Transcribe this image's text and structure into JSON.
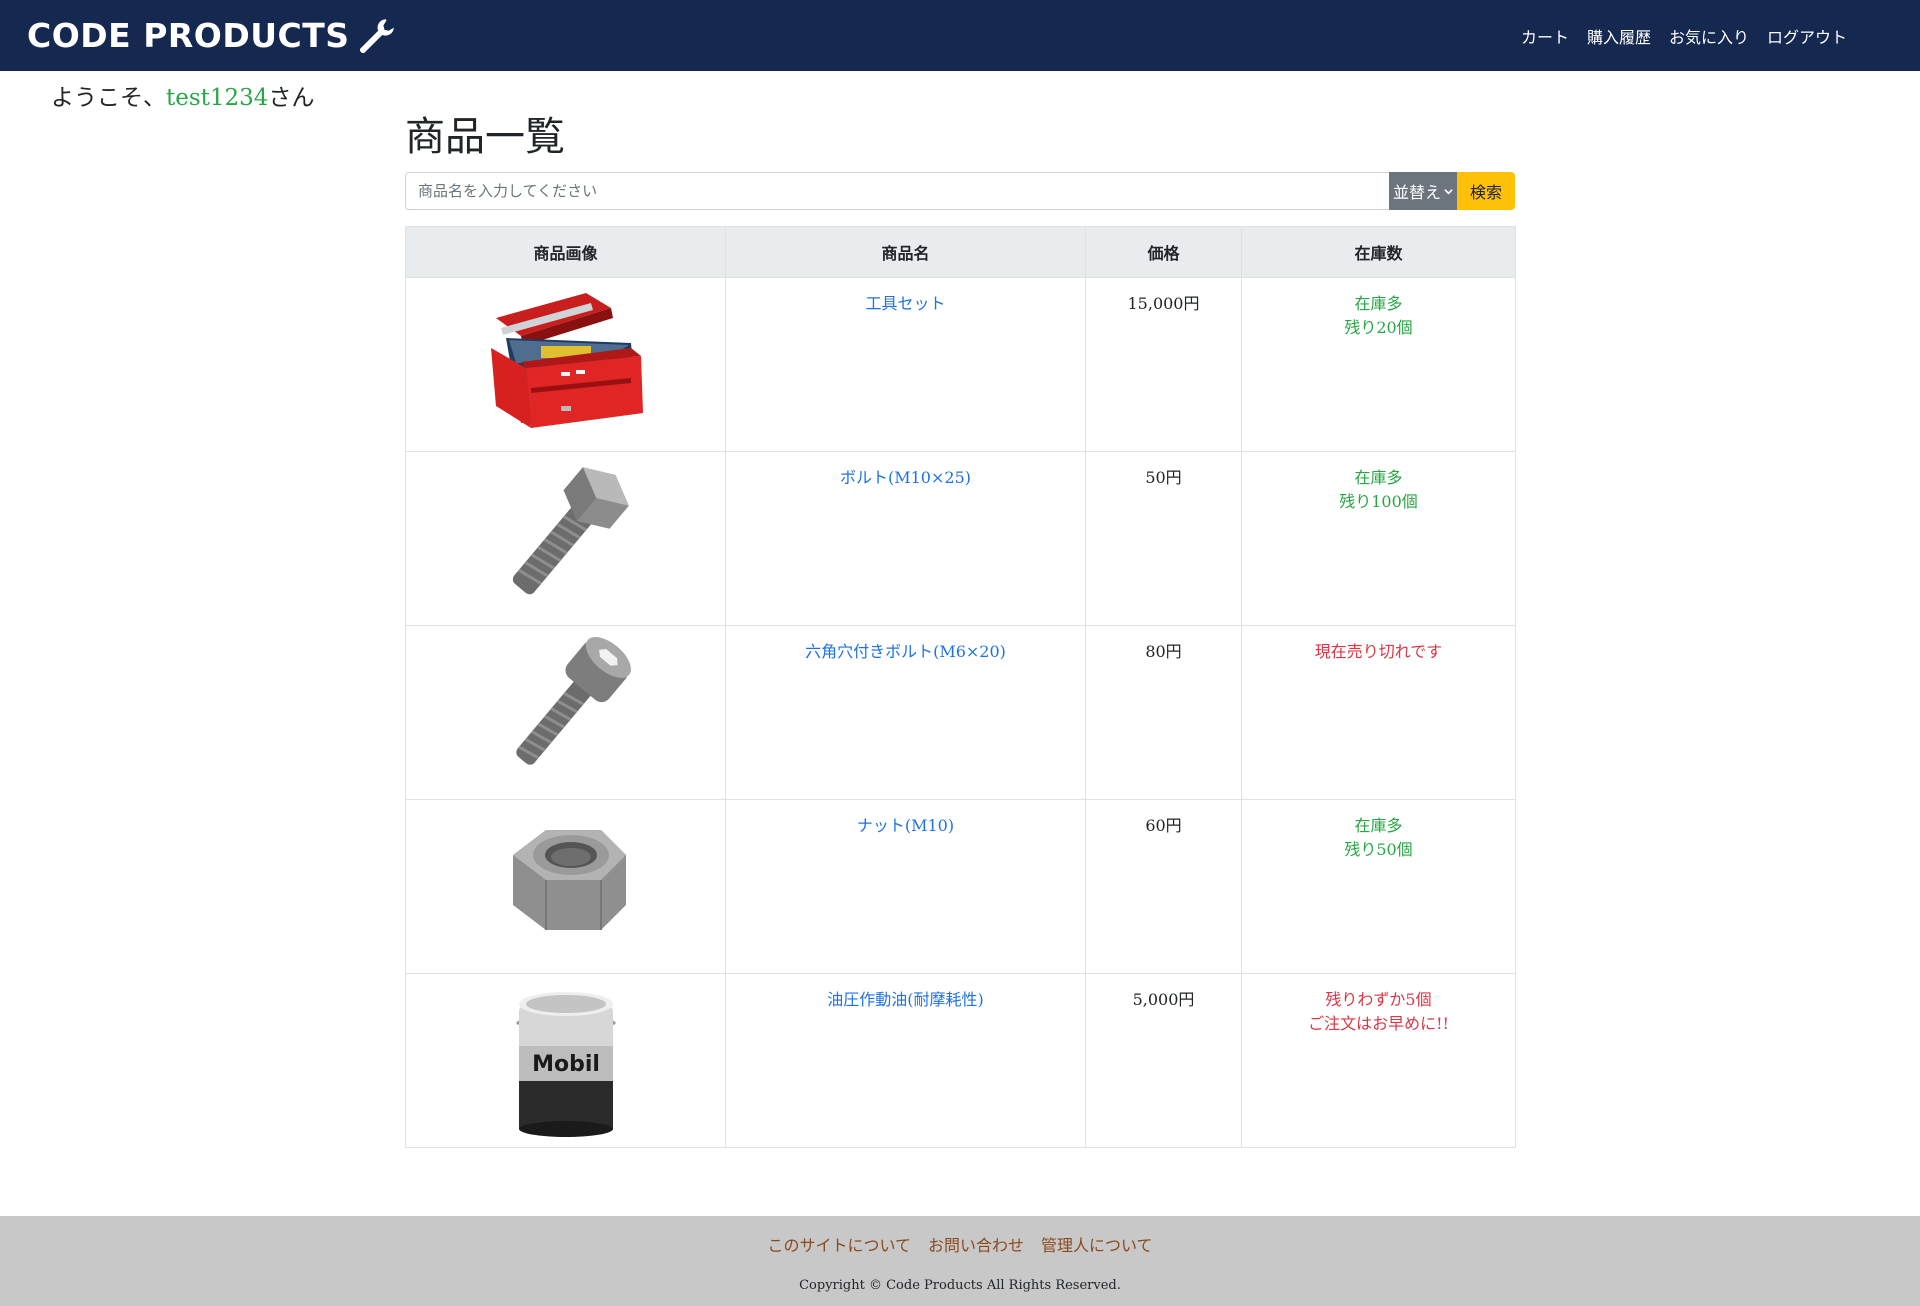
{
  "header": {
    "brand": "CODE PRODUCTS",
    "nav": [
      "カート",
      "購入履歴",
      "お気に入り",
      "ログアウト"
    ]
  },
  "welcome": {
    "prefix": "ようこそ、",
    "username": "test1234",
    "suffix": "さん"
  },
  "page_title": "商品一覧",
  "search": {
    "placeholder": "商品名を入力してください",
    "sort_label": "並替え",
    "button_label": "検索"
  },
  "table": {
    "headers": [
      "商品画像",
      "商品名",
      "価格",
      "在庫数"
    ],
    "rows": [
      {
        "icon": "toolbox-image",
        "name": "工具セット",
        "price": "15,000円",
        "stock_line1": "在庫多",
        "stock_line2": "残り20個",
        "status": "ok"
      },
      {
        "icon": "bolt-image",
        "name": "ボルト(M10×25)",
        "price": "50円",
        "stock_line1": "在庫多",
        "stock_line2": "残り100個",
        "status": "ok"
      },
      {
        "icon": "hex-socket-bolt-image",
        "name": "六角穴付きボルト(M6×20)",
        "price": "80円",
        "stock_line1": "現在売り切れです",
        "stock_line2": "",
        "status": "out"
      },
      {
        "icon": "nut-image",
        "name": "ナット(M10)",
        "price": "60円",
        "stock_line1": "在庫多",
        "stock_line2": "残り50個",
        "status": "ok"
      },
      {
        "icon": "oil-can-image",
        "name": "油圧作動油(耐摩耗性)",
        "price": "5,000円",
        "stock_line1": "残りわずか5個",
        "stock_line2": "ご注文はお早めに!!",
        "status": "low"
      }
    ]
  },
  "can_label": "Mobil",
  "footer": {
    "links": [
      "このサイトについて",
      "お問い合わせ",
      "管理人について"
    ],
    "copyright": "Copyright © Code Products All Rights Reserved."
  },
  "colors": {
    "navbar": "#142850",
    "link": "#1e72e6",
    "stock_ok": "#28a745",
    "stock_warn": "#dc3545",
    "search_button": "#ffc107",
    "sort_button": "#6c757d",
    "footer": "#c8c8c8"
  }
}
